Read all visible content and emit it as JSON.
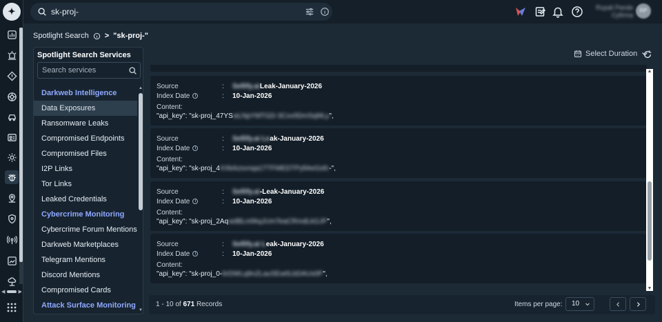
{
  "topbar": {
    "search_value": "sk-proj-",
    "user_name": "Rupali Pande",
    "user_role": "Cyfirma",
    "avatar_initials": "RP"
  },
  "breadcrumb": {
    "root": "Spotlight Search",
    "separator": ">",
    "current": "\"sk-proj-\""
  },
  "services": {
    "title": "Spotlight Search Services",
    "search_placeholder": "Search services",
    "items": [
      {
        "label": "Darkweb Intelligence",
        "kind": "category"
      },
      {
        "label": "Data Exposures",
        "kind": "selected"
      },
      {
        "label": "Ransomware Leaks",
        "kind": "item"
      },
      {
        "label": "Compromised Endpoints",
        "kind": "item"
      },
      {
        "label": "Compromised Files",
        "kind": "item"
      },
      {
        "label": "I2P Links",
        "kind": "item"
      },
      {
        "label": "Tor Links",
        "kind": "item"
      },
      {
        "label": "Leaked Credentials",
        "kind": "item"
      },
      {
        "label": "Cybercrime Monitoring",
        "kind": "category"
      },
      {
        "label": "Cybercrime Forum Mentions",
        "kind": "item"
      },
      {
        "label": "Darkweb Marketplaces",
        "kind": "item"
      },
      {
        "label": "Telegram Mentions",
        "kind": "item"
      },
      {
        "label": "Discord Mentions",
        "kind": "item"
      },
      {
        "label": "Compromised Cards",
        "kind": "item"
      },
      {
        "label": "Attack Surface Monitoring",
        "kind": "category"
      }
    ]
  },
  "filters": {
    "duration_label": "Select Duration"
  },
  "result_labels": {
    "source": "Source",
    "index_date": "Index Date",
    "content": "Content:",
    "colon": ":"
  },
  "results": [
    {
      "source_hidden": "Sellify.ai",
      "source_suffix": "Leak-January-2026",
      "index_date": "10-Jan-2026",
      "content_prefix": "\"api_key\": \"sk-proj_47YS",
      "content_hidden": "wLNpYMTGD-3Cxv0DmSqMLy",
      "content_suffix": "\","
    },
    {
      "source_hidden": "Sellify.ai Le",
      "source_suffix": "ak-January-2026",
      "index_date": "10-Jan-2026",
      "content_prefix": "\"api_key\": \"sk-proj_4",
      "content_hidden": "XXkAzsvnqa1TTFMEDTPyfiAeGsfc",
      "content_suffix": "-\","
    },
    {
      "source_hidden": "Sellify.ai",
      "source_suffix": "-Leak-January-2026",
      "index_date": "10-Jan-2026",
      "content_prefix": "\"api_key\": \"sk-proj_2Aq",
      "content_hidden": "wdBLmfAqJUmTeaCRmdLkGJP",
      "content_suffix": "\","
    },
    {
      "source_hidden": "Sellify.ai L",
      "source_suffix": "eak-January-2026",
      "index_date": "10-Jan-2026",
      "content_prefix": "\"api_key\": \"sk-proj_0-",
      "content_hidden": "6rDWLq9nZLauSEw0LbDAUs0P",
      "content_suffix": "\","
    }
  ],
  "pager": {
    "range_text": "1 - 10 of",
    "total": "671",
    "records_label": "Records",
    "items_per_page_label": "Items per page:",
    "items_per_page_value": "10"
  }
}
